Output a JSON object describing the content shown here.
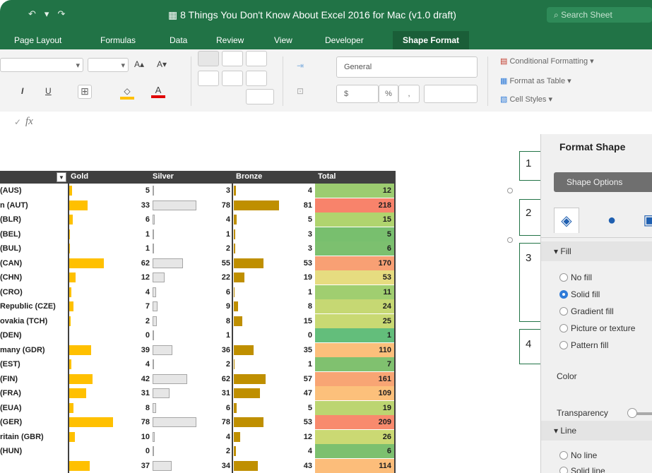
{
  "window": {
    "title": "8 Things You Don't Know About Excel 2016 for Mac (v1.0 draft)",
    "search_placeholder": "Search Sheet",
    "undo_glyph": "↶",
    "redo_glyph": "↷"
  },
  "tabs": [
    "Page Layout",
    "Formulas",
    "Data",
    "Review",
    "View",
    "Developer",
    "Shape Format"
  ],
  "active_tab": "Shape Format",
  "ribbon": {
    "font_size_arrow": "▾",
    "increase_font": "A▴",
    "decrease_font": "A▾",
    "italic": "I",
    "underline": "U",
    "number_format": "General",
    "currency": "$",
    "percent": "%",
    "comma": ",",
    "conditional_formatting": "Conditional Formatting ▾",
    "format_as_table": "Format as Table ▾",
    "cell_styles": "Cell Styles ▾"
  },
  "formula_bar": {
    "fx": "fx"
  },
  "table": {
    "headers": [
      "Gold",
      "Silver",
      "Bronze",
      "Total"
    ],
    "rows": [
      {
        "country": "(AUS)",
        "gold": 5,
        "silver": 3,
        "bronze": 4,
        "total": 12,
        "color": "#9ccc70"
      },
      {
        "country": "n (AUT)",
        "gold": 33,
        "silver": 78,
        "bronze": 81,
        "total": 218,
        "color": "#f8836b"
      },
      {
        "country": "(BLR)",
        "gold": 6,
        "silver": 4,
        "bronze": 5,
        "total": 15,
        "color": "#b0d46e"
      },
      {
        "country": "(BEL)",
        "gold": 1,
        "silver": 1,
        "bronze": 3,
        "total": 5,
        "color": "#78bf6e"
      },
      {
        "country": "(BUL)",
        "gold": 1,
        "silver": 2,
        "bronze": 3,
        "total": 6,
        "color": "#7cc06f"
      },
      {
        "country": "(CAN)",
        "gold": 62,
        "silver": 55,
        "bronze": 53,
        "total": 170,
        "color": "#f8a074"
      },
      {
        "country": "(CHN)",
        "gold": 12,
        "silver": 22,
        "bronze": 19,
        "total": 53,
        "color": "#e6dc80"
      },
      {
        "country": "(CRO)",
        "gold": 4,
        "silver": 6,
        "bronze": 1,
        "total": 11,
        "color": "#a0ce70"
      },
      {
        "country": "Republic (CZE)",
        "gold": 7,
        "silver": 9,
        "bronze": 8,
        "total": 24,
        "color": "#c6d873"
      },
      {
        "country": "ovakia (TCH)",
        "gold": 2,
        "silver": 8,
        "bronze": 15,
        "total": 25,
        "color": "#c9d973"
      },
      {
        "country": "(DEN)",
        "gold": 0,
        "silver": 1,
        "bronze": 0,
        "total": 1,
        "color": "#63be7b"
      },
      {
        "country": "many (GDR)",
        "gold": 39,
        "silver": 36,
        "bronze": 35,
        "total": 110,
        "color": "#fcbf7b"
      },
      {
        "country": "(EST)",
        "gold": 4,
        "silver": 2,
        "bronze": 1,
        "total": 7,
        "color": "#80c16f"
      },
      {
        "country": "(FIN)",
        "gold": 42,
        "silver": 62,
        "bronze": 57,
        "total": 161,
        "color": "#f8a574"
      },
      {
        "country": "(FRA)",
        "gold": 31,
        "silver": 31,
        "bronze": 47,
        "total": 109,
        "color": "#fcc07b"
      },
      {
        "country": "(EUA)",
        "gold": 8,
        "silver": 6,
        "bronze": 5,
        "total": 19,
        "color": "#bcd571"
      },
      {
        "country": "(GER)",
        "gold": 78,
        "silver": 78,
        "bronze": 53,
        "total": 209,
        "color": "#f88a6d"
      },
      {
        "country": "ritain (GBR)",
        "gold": 10,
        "silver": 4,
        "bronze": 12,
        "total": 26,
        "color": "#cbd973"
      },
      {
        "country": "(HUN)",
        "gold": 0,
        "silver": 2,
        "bronze": 4,
        "total": 6,
        "color": "#7cc06f"
      },
      {
        "country": "",
        "gold": 37,
        "silver": 34,
        "bronze": 43,
        "total": 114,
        "color": "#fcbd7a"
      }
    ]
  },
  "callouts": [
    "1",
    "2",
    "3",
    "4"
  ],
  "format_panel": {
    "title": "Format Shape",
    "options_button": "Shape Options",
    "fill_section": "▾ Fill",
    "fill_options": [
      "No fill",
      "Solid fill",
      "Gradient fill",
      "Picture or texture",
      "Pattern fill"
    ],
    "fill_selected": "Solid fill",
    "color_label": "Color",
    "transparency_label": "Transparency",
    "line_section": "▾ Line",
    "line_options": [
      "No line",
      "Solid line"
    ]
  }
}
